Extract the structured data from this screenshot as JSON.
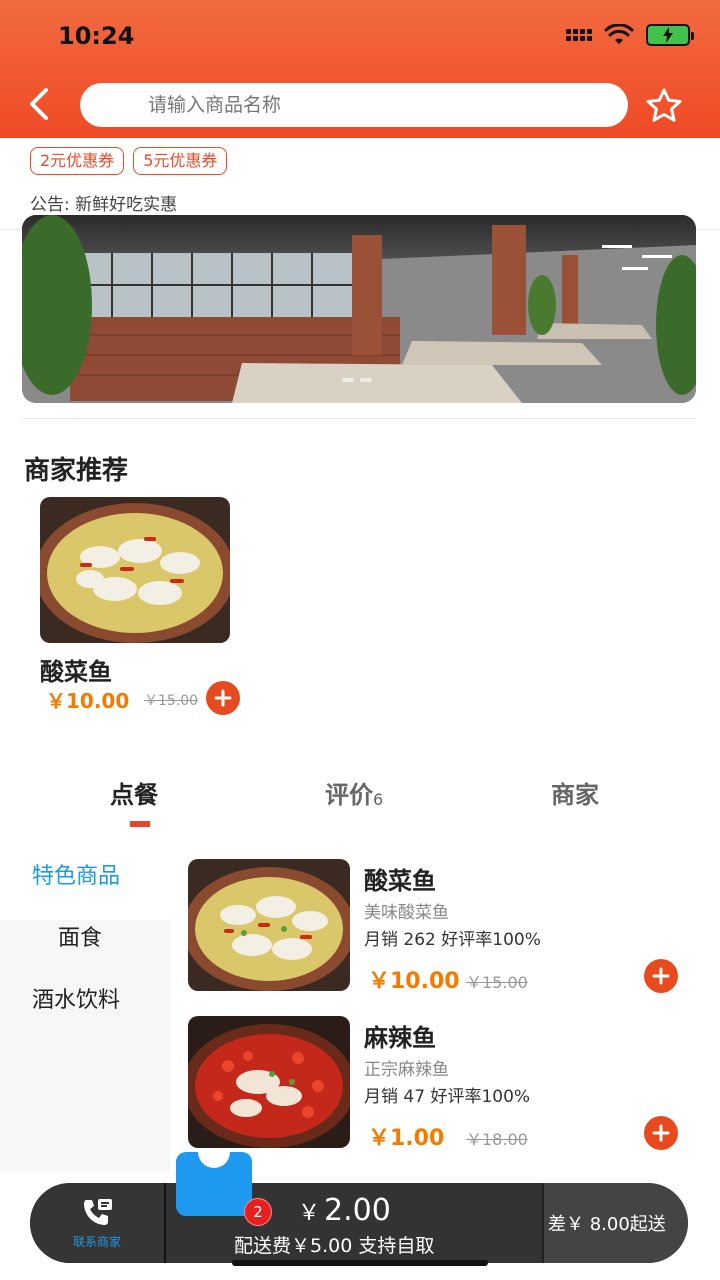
{
  "status_bar": {
    "time": "10:24"
  },
  "search": {
    "placeholder": "请输入商品名称"
  },
  "coupons": [
    "2元优惠券",
    "5元优惠券"
  ],
  "notice": "公告:  新鲜好吃实惠",
  "recommend": {
    "title": "商家推荐",
    "item": {
      "name": "酸菜鱼",
      "price": "￥10.00",
      "old_price": "￥15.00"
    }
  },
  "tabs": {
    "order": "点餐",
    "reviews": "评价",
    "reviews_count": "6",
    "shop": "商家"
  },
  "categories": [
    "特色商品",
    "面食",
    "酒水饮料"
  ],
  "items": [
    {
      "name": "酸菜鱼",
      "desc": "美味酸菜鱼",
      "stats": "月销 262   好评率100%",
      "price": "￥10.00",
      "old_price": "￥15.00"
    },
    {
      "name": "麻辣鱼",
      "desc": "正宗麻辣鱼",
      "stats": "月销 47   好评率100%",
      "price": "￥1.00",
      "old_price": "￥18.00"
    }
  ],
  "cart": {
    "contact_label": "联系商家",
    "badge": "2",
    "currency": "￥",
    "total": "2.00",
    "fee_text": "配送费￥5.00 支持自取",
    "short_text": "差￥ 8.00起送"
  },
  "colors": {
    "accent": "#ef4a26",
    "price": "#f57a00",
    "blue": "#1a9be6"
  }
}
